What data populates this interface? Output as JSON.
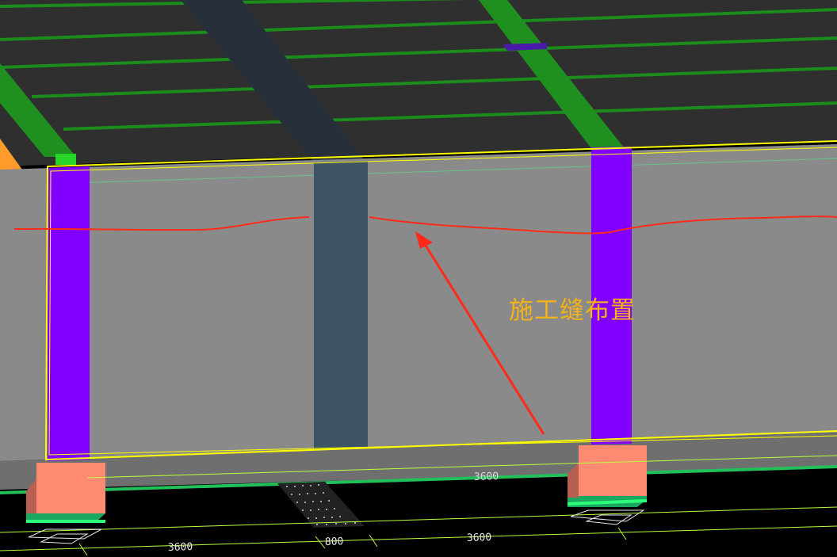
{
  "annotation": {
    "label": "施工缝布置",
    "label_color": "#f2b21a",
    "line_color": "#ff2a1a"
  },
  "dimensions": {
    "left_span": "3600",
    "middle_span": "800",
    "right_span": "3600",
    "partially_hidden_span": "3600"
  },
  "colors": {
    "background": "#000000",
    "slab": "#2f2f2f",
    "beam": "#1f8f1f",
    "wall": "#8a8a8a",
    "column": "#8200ff",
    "opening": "#3e5366",
    "footing": "#ff8a72",
    "outline": "#ffff00",
    "ground_line": "#22c05a",
    "dimension_line": "#b9ff3c"
  }
}
